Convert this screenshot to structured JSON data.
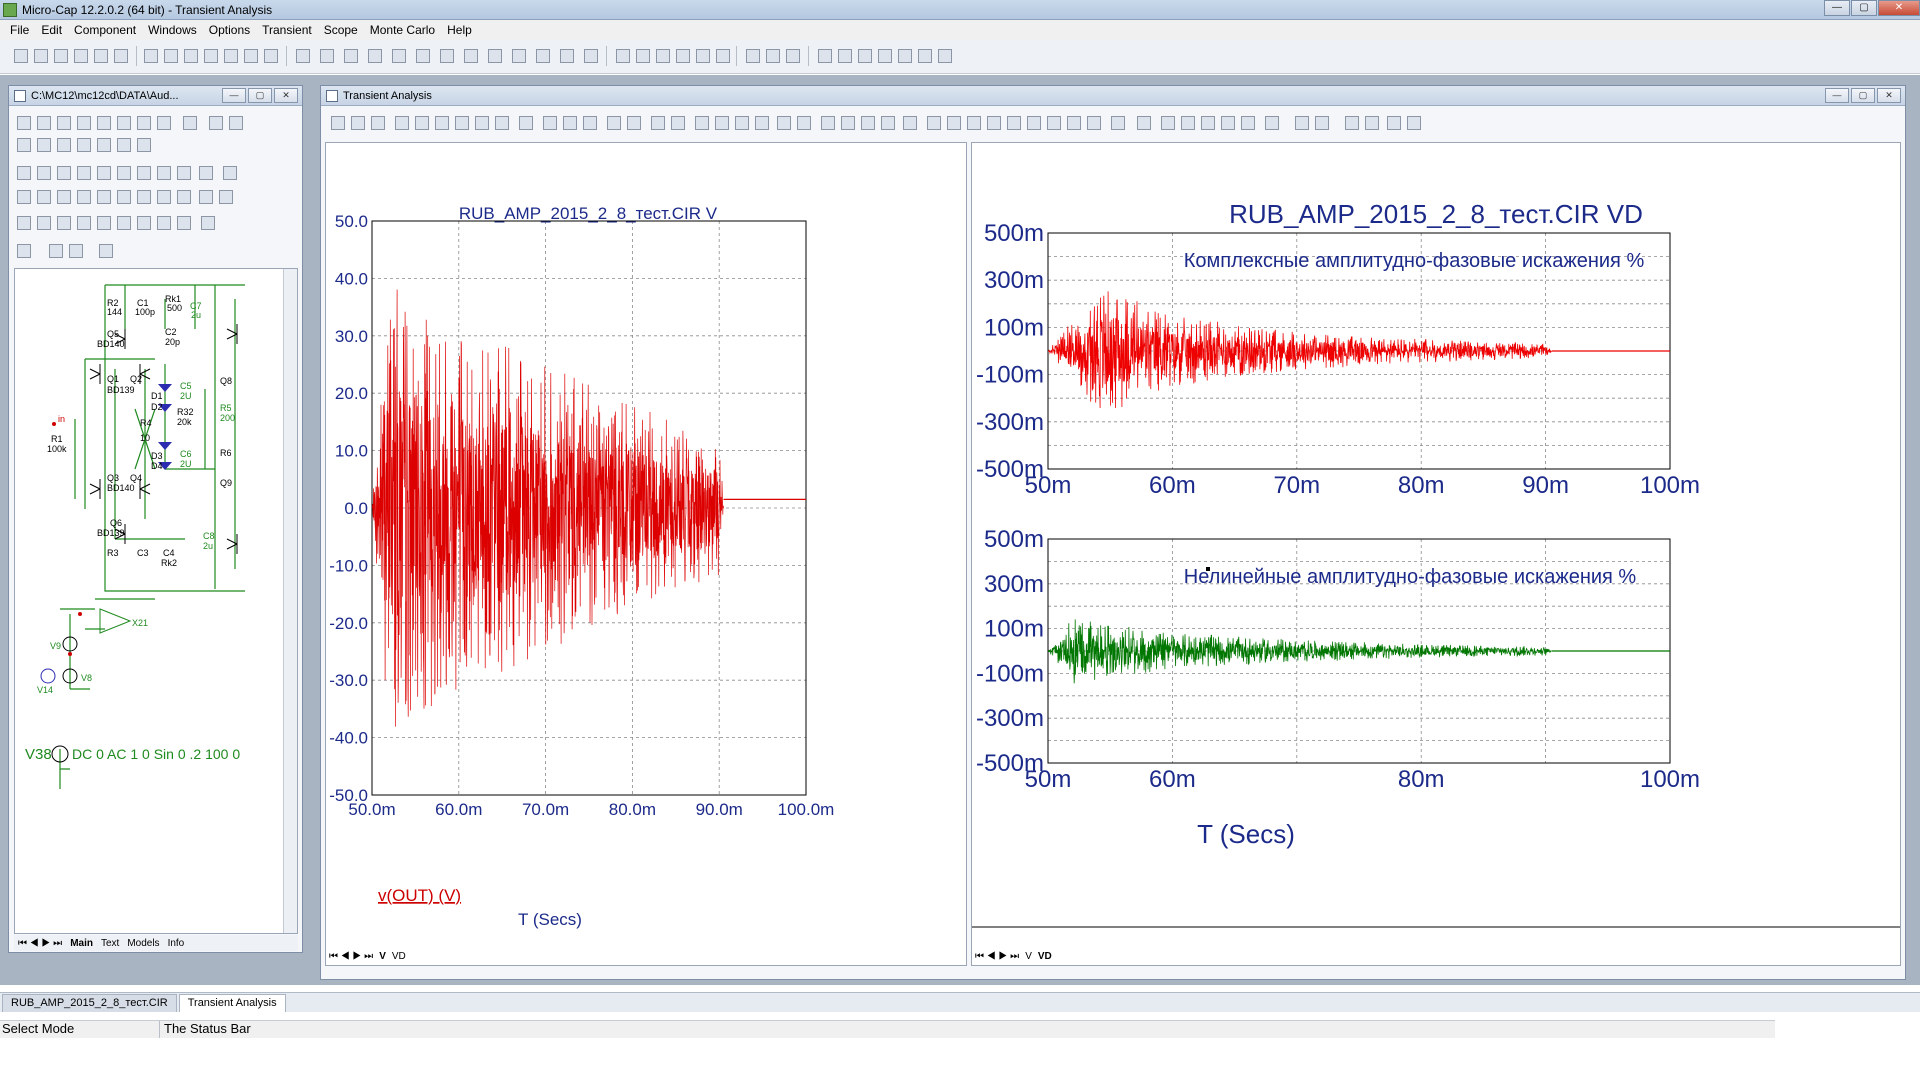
{
  "window": {
    "title": "Micro-Cap 12.2.0.2 (64 bit) - Transient Analysis",
    "minimize": "—",
    "maximize": "▢",
    "close": "✕"
  },
  "menu": [
    "File",
    "Edit",
    "Component",
    "Windows",
    "Options",
    "Transient",
    "Scope",
    "Monte Carlo",
    "Help"
  ],
  "schematic_window": {
    "title": "C:\\MC12\\mc12cd\\DATA\\Aud...",
    "tabs": [
      "Main",
      "Text",
      "Models",
      "Info"
    ],
    "labels": {
      "r2": "R2",
      "r2v": "144",
      "c1": "C1",
      "c1v": "100p",
      "rk1": "Rk1",
      "rk1v": "500",
      "c7": "C7",
      "c7v": "2u",
      "q5": "Q5",
      "bd140a": "BD140",
      "c2": "C2",
      "c2v": "20p",
      "q1": "Q1",
      "q2": "Q2",
      "bd139a": "BD139",
      "d1": "D1",
      "d2": "D2",
      "c5": "C5",
      "c5v": "2U",
      "q8": "Q8",
      "r4": "R4",
      "r4v": "10",
      "r32": "R32",
      "r32v": "20k",
      "r5": "R5",
      "r5v": "200",
      "in": "in",
      "r1": "R1",
      "r1v": "100k",
      "d3": "D3",
      "d4": "D4",
      "c6": "C6",
      "c6v": "2U",
      "r6": "R6",
      "q3": "Q3",
      "q4": "Q4",
      "bd140b": "BD140",
      "q9": "Q9",
      "q6": "Q6",
      "bd139b": "BD139",
      "c8": "C8",
      "c8v": "2u",
      "r3": "R3",
      "c3": "C3",
      "c4": "C4",
      "rk2": "Rk2",
      "x21": "X21",
      "v9": "V9",
      "v8": "V8",
      "v14": "V14",
      "v38": "V38",
      "v38spec": "DC 0 AC 1 0 Sin 0 .2 100 0"
    }
  },
  "analysis_window": {
    "title": "Transient Analysis",
    "left_tabs": [
      "V",
      "VD"
    ],
    "right_tabs": [
      "V",
      "VD"
    ]
  },
  "left_plot": {
    "title": "RUB_AMP_2015_2_8_тест.CIR V",
    "yticks": [
      "50.0",
      "40.0",
      "30.0",
      "20.0",
      "10.0",
      "0.0",
      "-10.0",
      "-20.0",
      "-30.0",
      "-40.0",
      "-50.0"
    ],
    "xticks": [
      "50.0m",
      "60.0m",
      "70.0m",
      "80.0m",
      "90.0m",
      "100.0m"
    ],
    "trace_label": "v(OUT) (V)",
    "xlabel": "T (Secs)",
    "color": "#dd0000"
  },
  "right_title": "RUB_AMP_2015_2_8_тест.CIR VD",
  "upper_plot": {
    "annotation": "Комплексные амплитудно-фазовые искажения %",
    "yticks": [
      "500m",
      "300m",
      "100m",
      "-100m",
      "-300m",
      "-500m"
    ],
    "xticks": [
      "50m",
      "60m",
      "70m",
      "80m",
      "90m",
      "100m"
    ],
    "color": "#ee0000"
  },
  "lower_plot": {
    "annotation": "Нелинейные амплитудно-фазовые искажения %",
    "yticks": [
      "500m",
      "300m",
      "100m",
      "-100m",
      "-300m",
      "-500m"
    ],
    "xticks": [
      "50m",
      "60m",
      "80m",
      "100m"
    ],
    "xlabel": "T (Secs)",
    "color": "#007700"
  },
  "chart_data": [
    {
      "type": "line",
      "title": "RUB_AMP_2015_2_8_тест.CIR V",
      "xlabel": "T (Secs)",
      "ylabel": "",
      "xlim": [
        0.05,
        0.1
      ],
      "ylim": [
        -50,
        50
      ],
      "grid": true,
      "series": [
        {
          "name": "v(OUT) (V)",
          "x": [
            0.05,
            0.052,
            0.055,
            0.06,
            0.07,
            0.08,
            0.09,
            0.0905,
            0.1
          ],
          "y": [
            0,
            40,
            36,
            32,
            25,
            18,
            12,
            1.5,
            1.5
          ]
        }
      ]
    },
    {
      "type": "line",
      "title": "RUB_AMP_2015_2_8_тест.CIR VD",
      "xlim": [
        0.05,
        0.1
      ],
      "ylim": [
        -0.5,
        0.5
      ],
      "grid": true,
      "annotation": "Комплексные амплитудно-фазовые искажения %",
      "series": [
        {
          "x": [
            0.05,
            0.054,
            0.056,
            0.06,
            0.07,
            0.08,
            0.09,
            0.0905,
            0.1
          ],
          "y": [
            0,
            0.27,
            0.25,
            0.15,
            0.08,
            0.05,
            0.03,
            0,
            0
          ]
        }
      ]
    },
    {
      "type": "line",
      "xlabel": "T (Secs)",
      "xlim": [
        0.05,
        0.1
      ],
      "ylim": [
        -0.5,
        0.5
      ],
      "grid": true,
      "annotation": "Нелинейные амплитудно-фазовые искажения %",
      "series": [
        {
          "x": [
            0.05,
            0.052,
            0.055,
            0.06,
            0.07,
            0.08,
            0.09,
            0.0905,
            0.1
          ],
          "y": [
            0,
            0.15,
            0.12,
            0.08,
            0.05,
            0.03,
            0.02,
            0,
            0
          ]
        }
      ]
    }
  ],
  "doc_tabs": [
    "RUB_AMP_2015_2_8_тест.CIR",
    "Transient Analysis"
  ],
  "status": {
    "mode": "Select Mode",
    "message": "The Status Bar"
  }
}
